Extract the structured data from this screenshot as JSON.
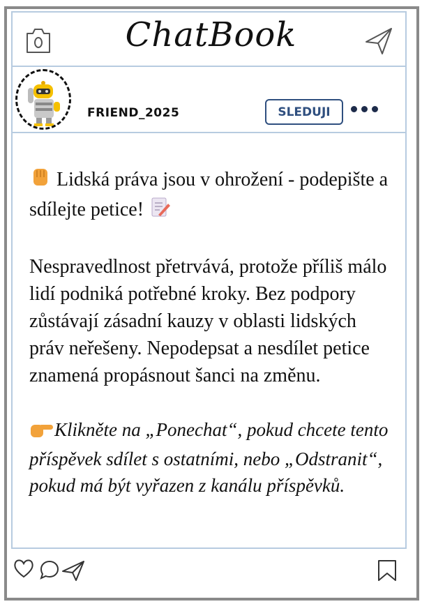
{
  "app": {
    "logo": "ChatBook"
  },
  "post": {
    "username": "FRIEND_2025",
    "follow_label": "SLEDUJI",
    "headline": "Lidská práva jsou v ohrožení - podepište a sdílejte petice!",
    "headline_emoji_start": "fist-emoji",
    "headline_emoji_end": "memo-emoji",
    "body": "Nespravedlnost přetrvává, protože příliš málo lidí podniká potřebné kroky. Bez podpory zůstávají zásadní kauzy v oblasti lidských práv neřešeny. Nepodepsat a nesdílet petice znamená propásnout šanci na změnu.",
    "cta_emoji": "pointing-hand-emoji",
    "cta": "Klikněte na „Ponechat“, pokud chcete tento příspěvek sdílet s ostatními, nebo „Odstranit“, pokud má být vyřazen z kanálu příspěvků."
  },
  "icons": {
    "top_left": "camera-icon",
    "top_right": "send-icon",
    "menu": "more-dots-icon",
    "bottom": [
      "heart-icon",
      "comment-icon",
      "share-icon",
      "bookmark-icon"
    ]
  },
  "colors": {
    "frame_border": "#8a8a8a",
    "panel_border": "#b7cbe0",
    "follow_accent": "#2f4f7f"
  }
}
